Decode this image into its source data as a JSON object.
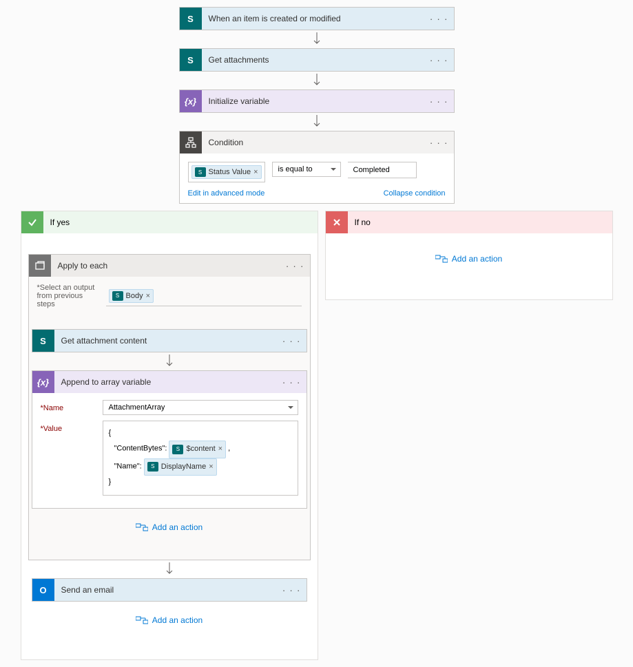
{
  "steps": {
    "s1": "When an item is created or modified",
    "s2": "Get attachments",
    "s3": "Initialize variable",
    "s4": "Condition",
    "s5": "Apply to each",
    "s6": "Get attachment content",
    "s7": "Append to array variable",
    "s8": "Send an email"
  },
  "cond": {
    "pill": "Status Value",
    "op": "is equal to",
    "val": "Completed",
    "edit": "Edit in advanced mode",
    "collapse": "Collapse condition"
  },
  "branch": {
    "yes": "If yes",
    "no": "If no"
  },
  "each": {
    "label": "*Select an output from previous steps",
    "pill": "Body"
  },
  "append": {
    "nameLbl": "*Name",
    "nameVal": "AttachmentArray",
    "valLbl": "*Value",
    "open": "{",
    "k1": "\"ContentBytes\":",
    "p1": "$content",
    "k2": "\"Name\":",
    "p2": "DisplayName",
    "close": "}"
  },
  "add": "Add an action"
}
